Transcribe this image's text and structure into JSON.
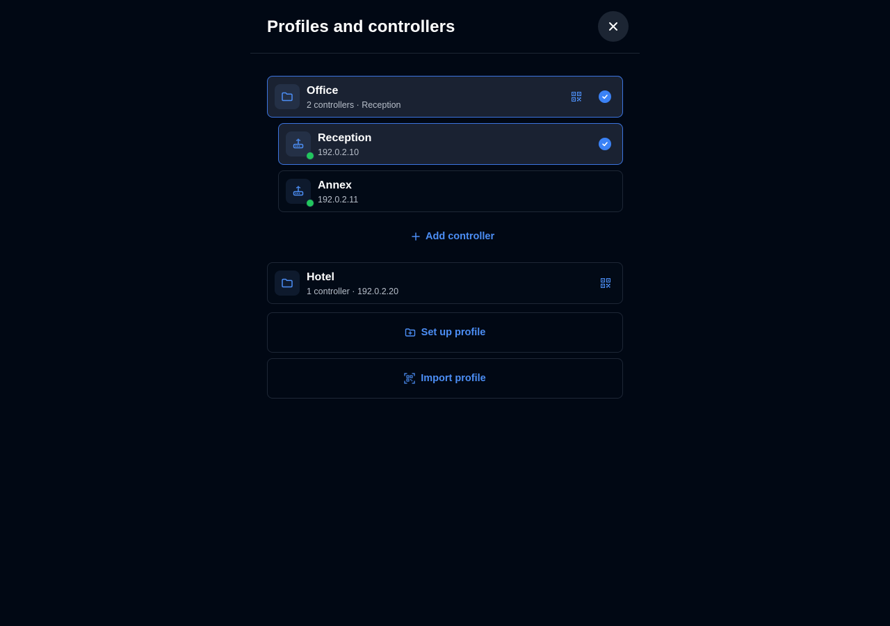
{
  "header": {
    "title": "Profiles and controllers",
    "close_icon": "close-icon"
  },
  "profiles": [
    {
      "name": "Office",
      "subtitle": "2 controllers · Reception",
      "selected": true,
      "icon": "folder-icon",
      "controllers": [
        {
          "name": "Reception",
          "ip": "192.0.2.10",
          "status": "online",
          "selected": true,
          "icon": "router-icon"
        },
        {
          "name": "Annex",
          "ip": "192.0.2.11",
          "status": "online",
          "selected": false,
          "icon": "router-icon"
        }
      ],
      "add_controller_label": "Add controller"
    },
    {
      "name": "Hotel",
      "subtitle": "1 controller · 192.0.2.20",
      "selected": false,
      "icon": "folder-icon"
    }
  ],
  "actions": {
    "setup_label": "Set up profile",
    "import_label": "Import profile"
  },
  "colors": {
    "background": "#010814",
    "accent": "#4c8ef5",
    "check": "#3b82f6",
    "online": "#22c55e",
    "selected_border": "#3b74e0"
  }
}
